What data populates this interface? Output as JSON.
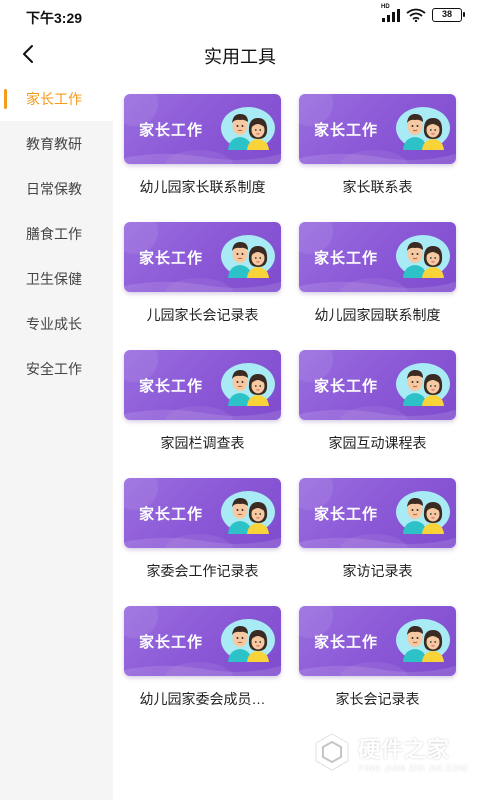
{
  "status_bar": {
    "time": "下午3:29",
    "network_label": "HD",
    "battery": "38",
    "icons": [
      "signal-icon",
      "wifi-icon",
      "battery-icon"
    ]
  },
  "header": {
    "back_icon": "back-arrow-icon",
    "title": "实用工具"
  },
  "colors": {
    "accent": "#f39b1b",
    "banner_purple": "#8a57d6",
    "sidebar_bg": "#f5f5f5"
  },
  "sidebar": {
    "items": [
      {
        "label": "家长工作",
        "active": true
      },
      {
        "label": "教育教研",
        "active": false
      },
      {
        "label": "日常保教",
        "active": false
      },
      {
        "label": "膳食工作",
        "active": false
      },
      {
        "label": "卫生保健",
        "active": false
      },
      {
        "label": "专业成长",
        "active": false
      },
      {
        "label": "安全工作",
        "active": false
      }
    ]
  },
  "tools": [
    {
      "banner": "家长工作",
      "label": "幼儿园家长联系制度"
    },
    {
      "banner": "家长工作",
      "label": "家长联系表"
    },
    {
      "banner": "家长工作",
      "label": "儿园家长会记录表"
    },
    {
      "banner": "家长工作",
      "label": "幼儿园家园联系制度"
    },
    {
      "banner": "家长工作",
      "label": "家园栏调查表"
    },
    {
      "banner": "家长工作",
      "label": "家园互动课程表"
    },
    {
      "banner": "家长工作",
      "label": "家委会工作记录表"
    },
    {
      "banner": "家长工作",
      "label": "家访记录表"
    },
    {
      "banner": "家长工作",
      "label": "幼儿园家委会成员…"
    },
    {
      "banner": "家长工作",
      "label": "家长会记录表"
    }
  ],
  "watermark": {
    "cn": "硬件之家",
    "en": "YING JIAN ZHI JIA.COM"
  }
}
